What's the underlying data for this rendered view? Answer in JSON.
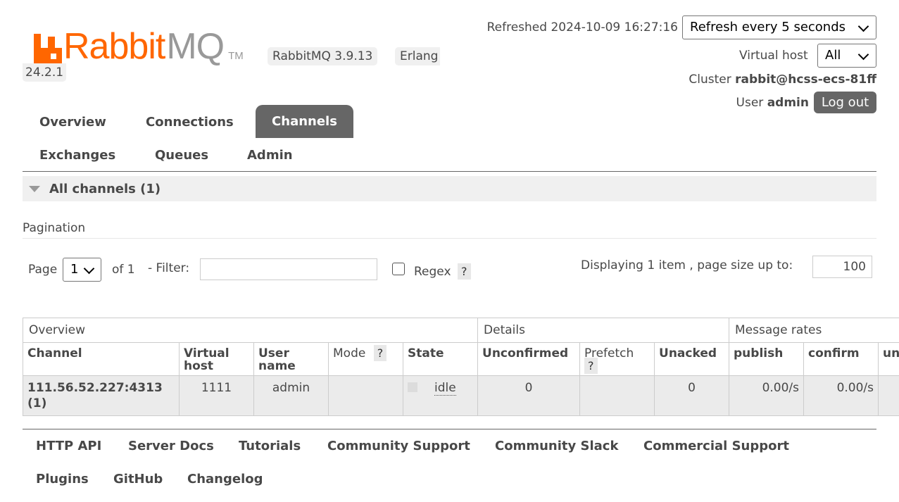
{
  "header": {
    "logo": {
      "word_rabbit": "Rabbit",
      "word_mq": "MQ",
      "tm": "TM"
    },
    "version_rabbit": "RabbitMQ 3.9.13",
    "version_erlang_label": "Erlang",
    "version_erlang_value": "24.2.1",
    "refreshed_text": "Refreshed 2024-10-09 16:27:16",
    "refresh_select_value": "Refresh every 5 seconds",
    "virtual_host_label": "Virtual host",
    "virtual_host_value": "All",
    "cluster_label": "Cluster",
    "cluster_value": "rabbit@hcss-ecs-81ff",
    "user_label": "User",
    "user_value": "admin",
    "logout_label": "Log out"
  },
  "tabs": {
    "overview": "Overview",
    "connections": "Connections",
    "channels": "Channels",
    "exchanges": "Exchanges",
    "queues": "Queues",
    "admin": "Admin"
  },
  "section": {
    "title": "All channels (1)"
  },
  "pagination": {
    "label": "Pagination",
    "page_label": "Page",
    "page_value": "1",
    "of_label": "of 1",
    "filter_label": "- Filter:",
    "regex_label": "Regex",
    "help": "?",
    "display_label": "Displaying 1 item , page size up to:",
    "page_size": "100"
  },
  "table": {
    "groups": {
      "overview": "Overview",
      "details": "Details",
      "message_rates": "Message rates"
    },
    "headers": {
      "channel": "Channel",
      "virtual_host": "Virtual host",
      "user_name": "User name",
      "mode": "Mode",
      "state": "State",
      "unconfirmed": "Unconfirmed",
      "prefetch": "Prefetch",
      "unacked": "Unacked",
      "publish": "publish",
      "confirm": "confirm",
      "next": "un (d"
    },
    "rows": [
      {
        "channel": "111.56.52.227:4313 (1)",
        "virtual_host": "1111",
        "user_name": "admin",
        "mode": "",
        "state": "idle",
        "unconfirmed": "0",
        "prefetch": "",
        "unacked": "0",
        "publish": "0.00/s",
        "confirm": "0.00/s"
      }
    ]
  },
  "footer": {
    "links": [
      "HTTP API",
      "Server Docs",
      "Tutorials",
      "Community Support",
      "Community Slack",
      "Commercial Support",
      "Plugins",
      "GitHub",
      "Changelog"
    ]
  }
}
